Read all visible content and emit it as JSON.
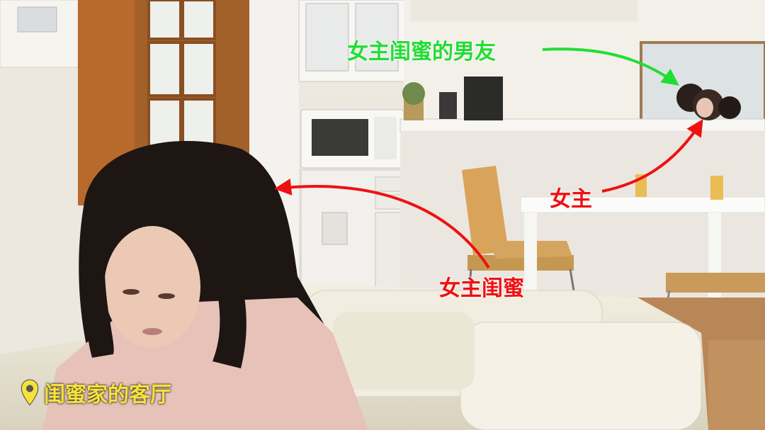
{
  "annotations": {
    "boyfriend": "女主闺蜜的男友",
    "heroine": "女主",
    "friend": "女主闺蜜"
  },
  "caption": {
    "icon": "location-pin-icon",
    "text": "闺蜜家的客厅"
  },
  "colors": {
    "green_label": "#22dd33",
    "red_label": "#ee1111",
    "caption_yellow": "#f7e23a"
  }
}
